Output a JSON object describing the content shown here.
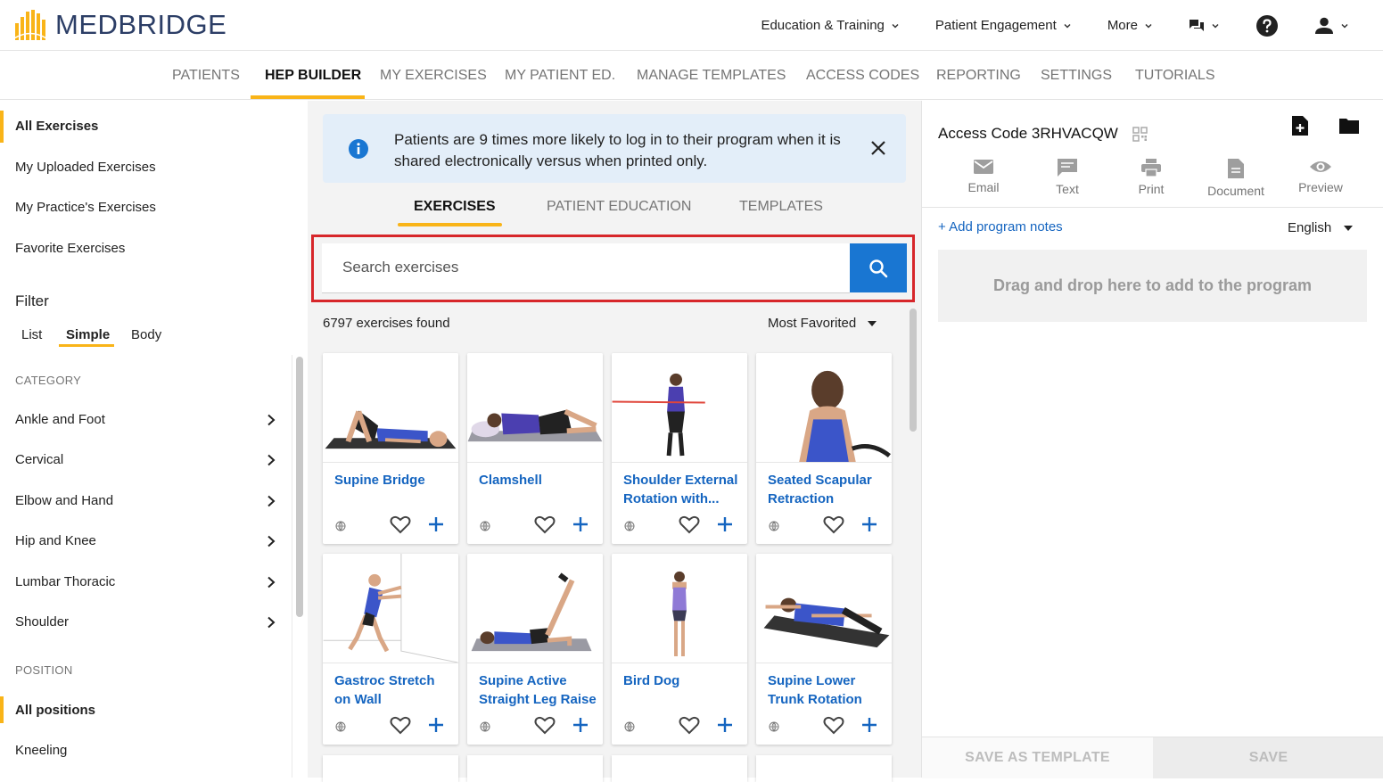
{
  "app": {
    "logo_text": "MEDBRIDGE"
  },
  "top_nav": {
    "education": "Education & Training",
    "engagement": "Patient Engagement",
    "more": "More"
  },
  "sub_nav": [
    "PATIENTS",
    "HEP BUILDER",
    "MY EXERCISES",
    "MY PATIENT ED.",
    "MANAGE TEMPLATES",
    "ACCESS CODES",
    "REPORTING",
    "SETTINGS",
    "TUTORIALS"
  ],
  "sidebar": {
    "links": [
      "All Exercises",
      "My Uploaded Exercises",
      "My Practice's Exercises",
      "Favorite Exercises"
    ],
    "filter_title": "Filter",
    "filter_tabs": [
      "List",
      "Simple",
      "Body"
    ],
    "category_heading": "CATEGORY",
    "categories": [
      "Ankle and Foot",
      "Cervical",
      "Elbow and Hand",
      "Hip and Knee",
      "Lumbar Thoracic",
      "Shoulder"
    ],
    "position_heading": "POSITION",
    "positions": [
      "All positions",
      "Kneeling"
    ]
  },
  "banner": {
    "text": "Patients are 9 times more likely to log in to their program when it is shared electronically versus when printed only."
  },
  "middle_tabs": [
    "EXERCISES",
    "PATIENT EDUCATION",
    "TEMPLATES"
  ],
  "search": {
    "placeholder": "Search exercises"
  },
  "results": {
    "count": "6797 exercises found",
    "sort": "Most Favorited"
  },
  "exercises": [
    {
      "title": "Supine Bridge"
    },
    {
      "title": "Clamshell"
    },
    {
      "title": "Shoulder External Rotation with..."
    },
    {
      "title": "Seated Scapular Retraction"
    },
    {
      "title": "Gastroc Stretch on Wall"
    },
    {
      "title": "Supine Active Straight Leg Raise"
    },
    {
      "title": "Bird Dog"
    },
    {
      "title": "Supine Lower Trunk Rotation"
    }
  ],
  "right_panel": {
    "access_code": "Access Code 3RHVACQW",
    "share": [
      "Email",
      "Text",
      "Print",
      "Document",
      "Preview"
    ],
    "add_notes": "+ Add program notes",
    "language": "English",
    "drop_zone": "Drag and drop here to add to the program",
    "save_template": "SAVE AS TEMPLATE",
    "save": "SAVE"
  },
  "colors": {
    "accent": "#f9b418",
    "link": "#1565c0",
    "search_button": "#1976d2",
    "highlight": "#d7262a"
  }
}
